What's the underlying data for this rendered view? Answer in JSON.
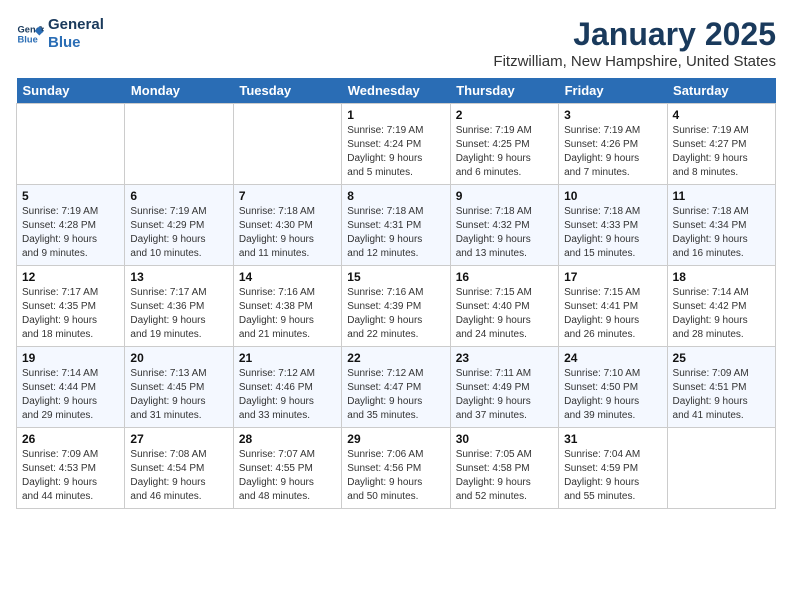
{
  "header": {
    "logo_line1": "General",
    "logo_line2": "Blue",
    "month": "January 2025",
    "location": "Fitzwilliam, New Hampshire, United States"
  },
  "days_of_week": [
    "Sunday",
    "Monday",
    "Tuesday",
    "Wednesday",
    "Thursday",
    "Friday",
    "Saturday"
  ],
  "weeks": [
    [
      {
        "day": "",
        "info": ""
      },
      {
        "day": "",
        "info": ""
      },
      {
        "day": "",
        "info": ""
      },
      {
        "day": "1",
        "info": "Sunrise: 7:19 AM\nSunset: 4:24 PM\nDaylight: 9 hours\nand 5 minutes."
      },
      {
        "day": "2",
        "info": "Sunrise: 7:19 AM\nSunset: 4:25 PM\nDaylight: 9 hours\nand 6 minutes."
      },
      {
        "day": "3",
        "info": "Sunrise: 7:19 AM\nSunset: 4:26 PM\nDaylight: 9 hours\nand 7 minutes."
      },
      {
        "day": "4",
        "info": "Sunrise: 7:19 AM\nSunset: 4:27 PM\nDaylight: 9 hours\nand 8 minutes."
      }
    ],
    [
      {
        "day": "5",
        "info": "Sunrise: 7:19 AM\nSunset: 4:28 PM\nDaylight: 9 hours\nand 9 minutes."
      },
      {
        "day": "6",
        "info": "Sunrise: 7:19 AM\nSunset: 4:29 PM\nDaylight: 9 hours\nand 10 minutes."
      },
      {
        "day": "7",
        "info": "Sunrise: 7:18 AM\nSunset: 4:30 PM\nDaylight: 9 hours\nand 11 minutes."
      },
      {
        "day": "8",
        "info": "Sunrise: 7:18 AM\nSunset: 4:31 PM\nDaylight: 9 hours\nand 12 minutes."
      },
      {
        "day": "9",
        "info": "Sunrise: 7:18 AM\nSunset: 4:32 PM\nDaylight: 9 hours\nand 13 minutes."
      },
      {
        "day": "10",
        "info": "Sunrise: 7:18 AM\nSunset: 4:33 PM\nDaylight: 9 hours\nand 15 minutes."
      },
      {
        "day": "11",
        "info": "Sunrise: 7:18 AM\nSunset: 4:34 PM\nDaylight: 9 hours\nand 16 minutes."
      }
    ],
    [
      {
        "day": "12",
        "info": "Sunrise: 7:17 AM\nSunset: 4:35 PM\nDaylight: 9 hours\nand 18 minutes."
      },
      {
        "day": "13",
        "info": "Sunrise: 7:17 AM\nSunset: 4:36 PM\nDaylight: 9 hours\nand 19 minutes."
      },
      {
        "day": "14",
        "info": "Sunrise: 7:16 AM\nSunset: 4:38 PM\nDaylight: 9 hours\nand 21 minutes."
      },
      {
        "day": "15",
        "info": "Sunrise: 7:16 AM\nSunset: 4:39 PM\nDaylight: 9 hours\nand 22 minutes."
      },
      {
        "day": "16",
        "info": "Sunrise: 7:15 AM\nSunset: 4:40 PM\nDaylight: 9 hours\nand 24 minutes."
      },
      {
        "day": "17",
        "info": "Sunrise: 7:15 AM\nSunset: 4:41 PM\nDaylight: 9 hours\nand 26 minutes."
      },
      {
        "day": "18",
        "info": "Sunrise: 7:14 AM\nSunset: 4:42 PM\nDaylight: 9 hours\nand 28 minutes."
      }
    ],
    [
      {
        "day": "19",
        "info": "Sunrise: 7:14 AM\nSunset: 4:44 PM\nDaylight: 9 hours\nand 29 minutes."
      },
      {
        "day": "20",
        "info": "Sunrise: 7:13 AM\nSunset: 4:45 PM\nDaylight: 9 hours\nand 31 minutes."
      },
      {
        "day": "21",
        "info": "Sunrise: 7:12 AM\nSunset: 4:46 PM\nDaylight: 9 hours\nand 33 minutes."
      },
      {
        "day": "22",
        "info": "Sunrise: 7:12 AM\nSunset: 4:47 PM\nDaylight: 9 hours\nand 35 minutes."
      },
      {
        "day": "23",
        "info": "Sunrise: 7:11 AM\nSunset: 4:49 PM\nDaylight: 9 hours\nand 37 minutes."
      },
      {
        "day": "24",
        "info": "Sunrise: 7:10 AM\nSunset: 4:50 PM\nDaylight: 9 hours\nand 39 minutes."
      },
      {
        "day": "25",
        "info": "Sunrise: 7:09 AM\nSunset: 4:51 PM\nDaylight: 9 hours\nand 41 minutes."
      }
    ],
    [
      {
        "day": "26",
        "info": "Sunrise: 7:09 AM\nSunset: 4:53 PM\nDaylight: 9 hours\nand 44 minutes."
      },
      {
        "day": "27",
        "info": "Sunrise: 7:08 AM\nSunset: 4:54 PM\nDaylight: 9 hours\nand 46 minutes."
      },
      {
        "day": "28",
        "info": "Sunrise: 7:07 AM\nSunset: 4:55 PM\nDaylight: 9 hours\nand 48 minutes."
      },
      {
        "day": "29",
        "info": "Sunrise: 7:06 AM\nSunset: 4:56 PM\nDaylight: 9 hours\nand 50 minutes."
      },
      {
        "day": "30",
        "info": "Sunrise: 7:05 AM\nSunset: 4:58 PM\nDaylight: 9 hours\nand 52 minutes."
      },
      {
        "day": "31",
        "info": "Sunrise: 7:04 AM\nSunset: 4:59 PM\nDaylight: 9 hours\nand 55 minutes."
      },
      {
        "day": "",
        "info": ""
      }
    ]
  ]
}
